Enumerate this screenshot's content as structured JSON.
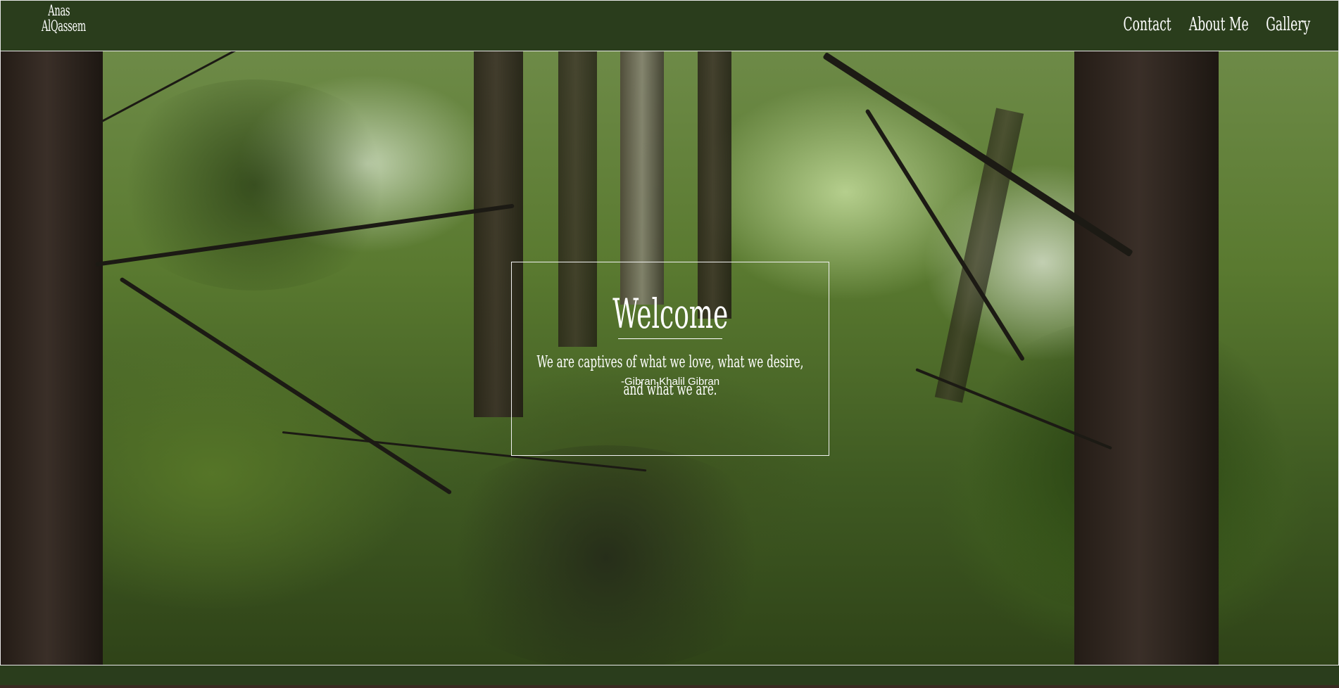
{
  "logo": {
    "line1": "Anas",
    "line2": "AlQassem"
  },
  "nav": [
    {
      "label": "Contact"
    },
    {
      "label": "About Me"
    },
    {
      "label": "Gallery"
    }
  ],
  "hero": {
    "title": "Welcome",
    "quote": "We are captives of what we love, what we desire, and what we are.",
    "author": "-Gibran Khalil Gibran"
  },
  "colors": {
    "brand_green": "#2a3d1c",
    "text": "#ffffff",
    "border": "#e8e8e8"
  }
}
